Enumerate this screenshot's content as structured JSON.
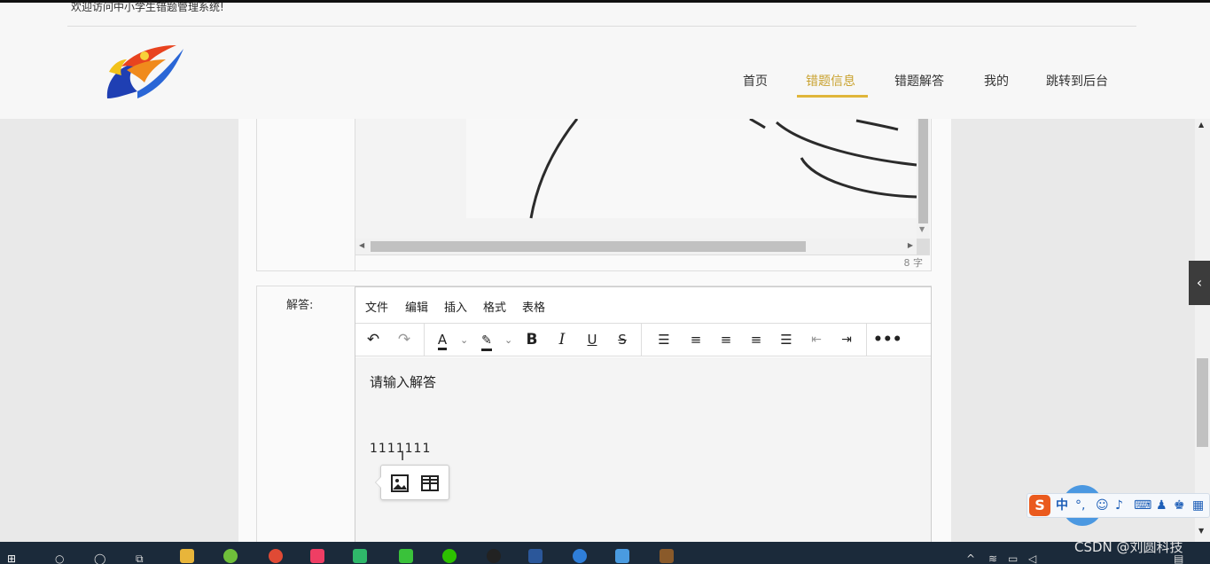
{
  "header": {
    "welcome": "欢迎访问中小学生错题管理系统!",
    "nav": [
      {
        "label": "首页"
      },
      {
        "label": "错题信息"
      },
      {
        "label": "错题解答"
      },
      {
        "label": "我的"
      },
      {
        "label": "跳转到后台"
      }
    ],
    "active_nav": "错题信息",
    "accent_color": "#e0b63a"
  },
  "image_field": {
    "word_count": "8 字"
  },
  "answer_field": {
    "label": "解答:",
    "menubar": [
      "文件",
      "编辑",
      "插入",
      "格式",
      "表格"
    ],
    "toolbar_icons": [
      "undo-icon",
      "redo-icon",
      "text-color-icon",
      "highlight-color-icon",
      "bold-icon",
      "italic-icon",
      "underline-icon",
      "strikethrough-icon",
      "line-height-icon",
      "align-left-icon",
      "align-center-icon",
      "align-right-icon",
      "align-justify-icon",
      "outdent-icon",
      "indent-icon",
      "more-icon"
    ],
    "content_lines": [
      "请输入解答",
      "1111111"
    ],
    "quick_insert": [
      "image-icon",
      "table-icon"
    ]
  },
  "ime": {
    "items": [
      "中",
      "°,"
    ]
  },
  "watermark": "CSDN @刘圆科技"
}
